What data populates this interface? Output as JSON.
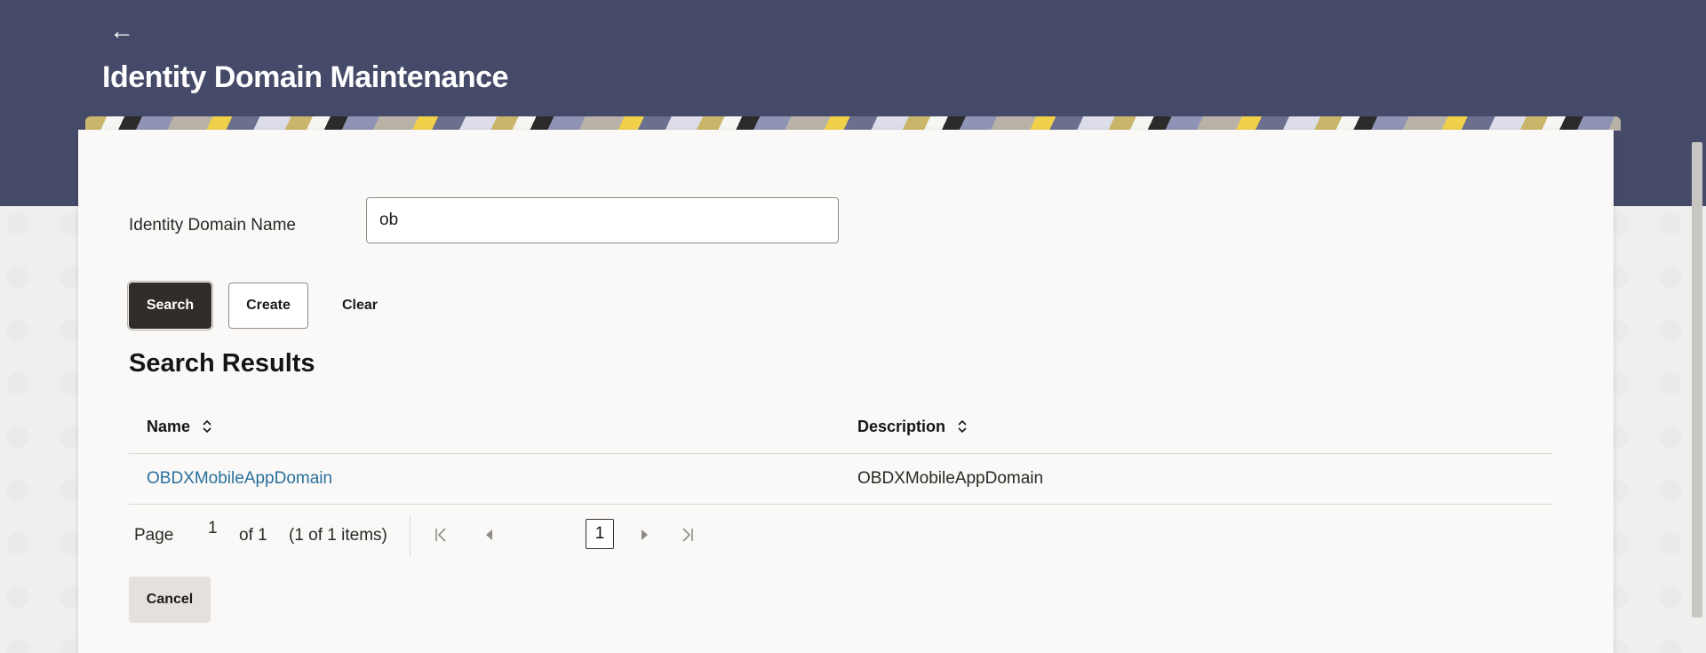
{
  "header": {
    "back_icon": "arrow-left-icon",
    "back_glyph": "←",
    "title": "Identity Domain Maintenance",
    "color": "#464a69"
  },
  "form": {
    "label": "Identity Domain Name",
    "input_value": "ob"
  },
  "buttons": {
    "search": "Search",
    "create": "Create",
    "clear": "Clear",
    "cancel": "Cancel"
  },
  "results": {
    "title": "Search Results",
    "columns": [
      "Name",
      "Description"
    ],
    "rows": [
      {
        "name": "OBDXMobileAppDomain",
        "description": "OBDXMobileAppDomain"
      }
    ]
  },
  "pagination": {
    "page_label": "Page",
    "page_value": "1",
    "of_label": "of 1",
    "items_label": "(1 of 1 items)",
    "current_page": "1"
  },
  "colors": {
    "link": "#29709c",
    "primary_button": "#312d2a"
  }
}
